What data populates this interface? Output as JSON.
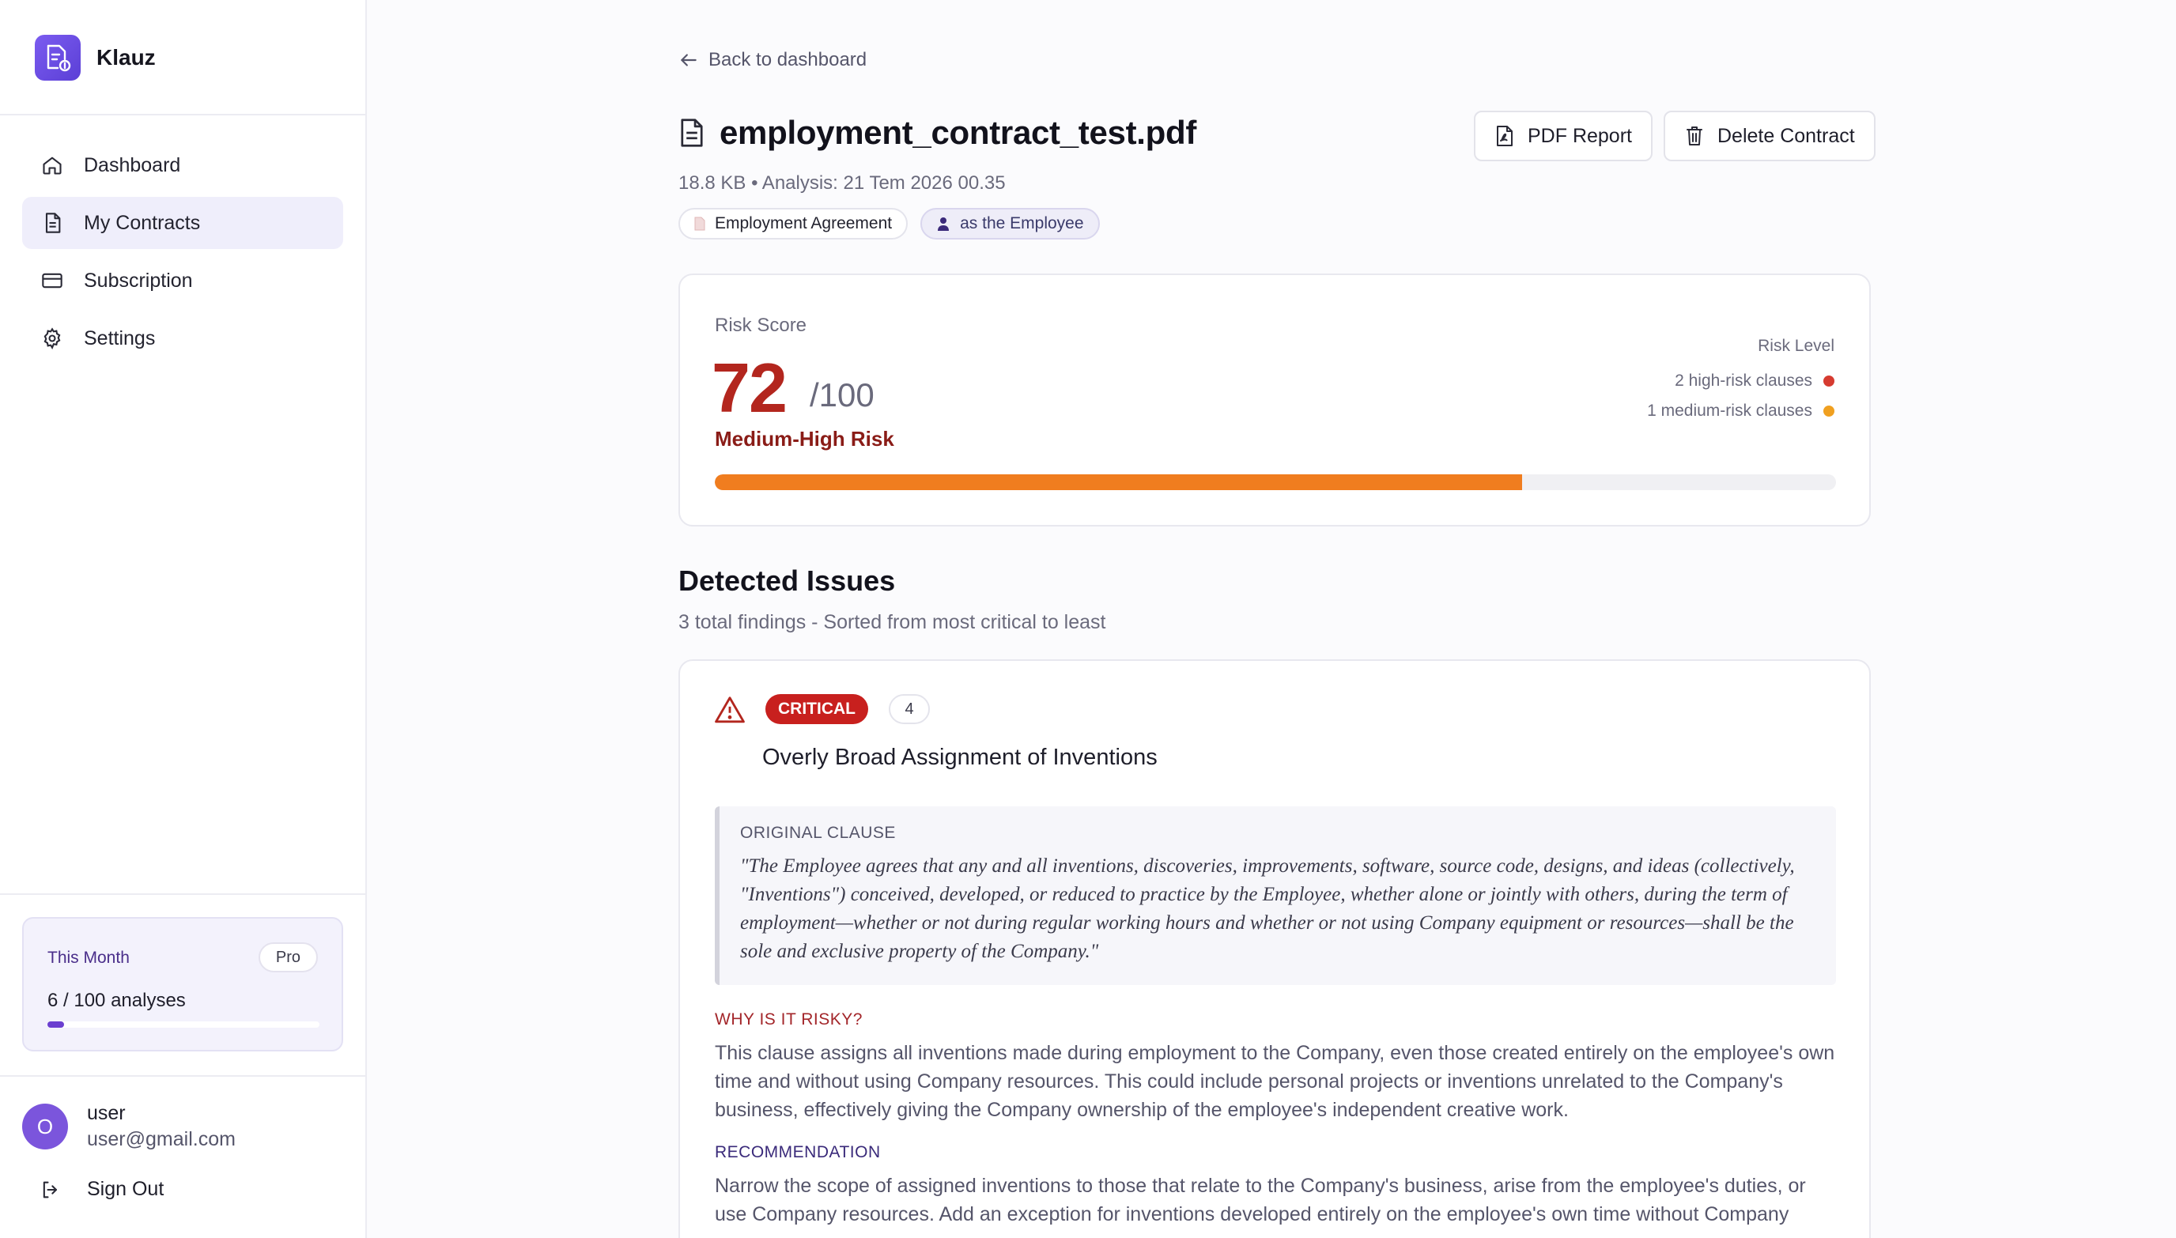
{
  "app": {
    "name": "Klauz"
  },
  "sidebar": {
    "items": [
      {
        "label": "Dashboard",
        "icon": "home-icon"
      },
      {
        "label": "My Contracts",
        "icon": "document-icon",
        "active": true
      },
      {
        "label": "Subscription",
        "icon": "card-icon"
      },
      {
        "label": "Settings",
        "icon": "gear-icon"
      }
    ],
    "usage": {
      "title": "This Month",
      "plan": "Pro",
      "count": "6 / 100 analyses",
      "used": 6,
      "limit": 100
    },
    "user": {
      "initial": "O",
      "name": "user",
      "email": "user@gmail.com"
    },
    "signout_label": "Sign Out"
  },
  "header": {
    "back_label": "Back to dashboard",
    "title": "employment_contract_test.pdf",
    "meta": "18.8 KB • Analysis: 21 Tem 2026 00.35",
    "chips": {
      "type": "Employment Agreement",
      "role": "as the Employee"
    },
    "actions": {
      "pdf": "PDF Report",
      "delete": "Delete Contract"
    }
  },
  "risk": {
    "label": "Risk Score",
    "score": "72",
    "max": "/100",
    "level": "Medium-High Risk",
    "side_title": "Risk Level",
    "high": "2 high-risk clauses",
    "medium": "1 medium-risk clauses",
    "percent": 72,
    "colors": {
      "score": "#b3261e",
      "bar": "#f07d1f",
      "high": "#d63b30",
      "medium": "#f0a020"
    }
  },
  "issues": {
    "title": "Detected Issues",
    "subtitle": "3 total findings - Sorted from most critical to least",
    "items": [
      {
        "severity": "CRITICAL",
        "count": "4",
        "title": "Overly Broad Assignment of Inventions",
        "clause_label": "ORIGINAL CLAUSE",
        "clause": "\"The Employee agrees that any and all inventions, discoveries, improvements, software, source code, designs, and ideas (collectively, \"Inventions\") conceived, developed, or reduced to practice by the Employee, whether alone or jointly with others, during the term of employment—whether or not during regular working hours and whether or not using Company equipment or resources—shall be the sole and exclusive property of the Company.\"",
        "why_label": "WHY IS IT RISKY?",
        "why": "This clause assigns all inventions made during employment to the Company, even those created entirely on the employee's own time and without using Company resources. This could include personal projects or inventions unrelated to the Company's business, effectively giving the Company ownership of the employee's independent creative work.",
        "rec_label": "RECOMMENDATION",
        "rec": "Narrow the scope of assigned inventions to those that relate to the Company's business, arise from the employee's duties, or use Company resources. Add an exception for inventions developed entirely on the employee's own time without Company"
      }
    ]
  }
}
